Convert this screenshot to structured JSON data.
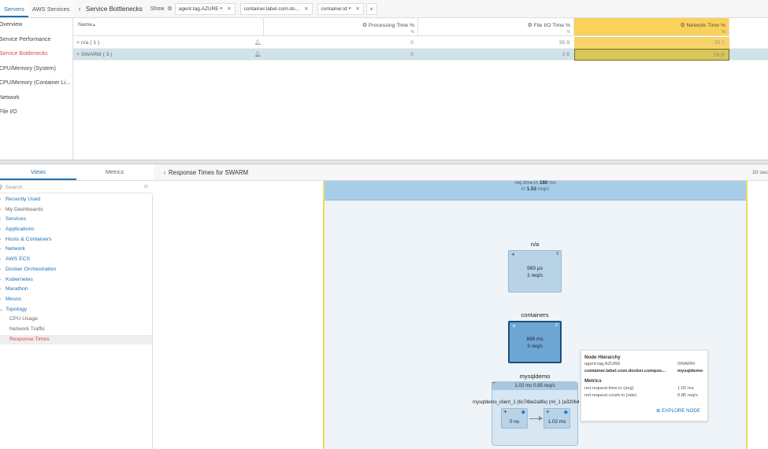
{
  "top_tabs": [
    "Servers",
    "AWS Services"
  ],
  "left_nav": [
    "Overview",
    "Service Performance",
    "Service Bottlenecks",
    "CPU/Memory (System)",
    "CPU/Memory (Container Lim...",
    "Network",
    "File I/O"
  ],
  "header": {
    "title": "Service Bottlenecks",
    "show_label": "Show",
    "chips": [
      "agent.tag.AZURE",
      "container.label.com.do...",
      "container.id"
    ],
    "add": "+"
  },
  "table": {
    "columns": [
      {
        "label": "Name",
        "sort": "▴",
        "unit": ""
      },
      {
        "label": "Processing Time %",
        "unit": "%"
      },
      {
        "label": "File I/O Time %",
        "unit": "%"
      },
      {
        "label": "Network Time %",
        "unit": "%"
      }
    ],
    "rows": [
      {
        "name": "n/a ( 1 )",
        "processing": "0",
        "fileio": "35.9",
        "network": "39.1"
      },
      {
        "name": "SWARM ( 3 )",
        "processing": "0",
        "fileio": "3.6",
        "network": "76.9"
      }
    ]
  },
  "lower_tabs": [
    "Views",
    "Metrics"
  ],
  "search": {
    "placeholder": "Search"
  },
  "tree": [
    {
      "label": "Recently Used",
      "link": true
    },
    {
      "label": "My Dashboards",
      "link": false
    },
    {
      "label": "Services",
      "link": true
    },
    {
      "label": "Applications",
      "link": true
    },
    {
      "label": "Hosts & Containers",
      "link": true
    },
    {
      "label": "Network",
      "link": true
    },
    {
      "label": "AWS ECS",
      "link": true
    },
    {
      "label": "Docker Orchestration",
      "link": true
    },
    {
      "label": "Kubernetes",
      "link": true
    },
    {
      "label": "Marathon",
      "link": true
    },
    {
      "label": "Mesos",
      "link": true
    },
    {
      "label": "Topology",
      "link": true
    },
    {
      "label": "CPU Usage",
      "link": false
    },
    {
      "label": "Network Traffic",
      "link": false
    },
    {
      "label": "Response Times",
      "link": false
    }
  ],
  "panel": {
    "title": "Response Times for SWARM",
    "seconds": "10 sec"
  },
  "topology": {
    "top_line1_pre": "req.time.in",
    "top_line1_val": "180",
    "top_line1_unit": "ms",
    "top_line2_pre": "in",
    "top_line2_val": "1.53",
    "top_line2_unit": "req/s",
    "na": {
      "title": "n/a",
      "count": "3",
      "time": "560 µs",
      "rate": "1 req/s"
    },
    "containers": {
      "title": "containers",
      "count": "2",
      "time": "899 ms",
      "rate": "3 req/s"
    },
    "group": {
      "title": "mysqldemo",
      "bar": "1.02 ms  0.85 req/s",
      "sub_label": "mysqldemo_client_1 (6c74be2a8fe) (ml_1 (a32064",
      "node1": "0 ns",
      "node2": "1.02 ms"
    }
  },
  "tooltip": {
    "hierarchy_title": "Node Hierarchy",
    "rows": [
      {
        "k": "agent.tag.AZURE",
        "v": "SWARM",
        "bold": false
      },
      {
        "k": "container.label.com.docker.compos...",
        "v": "mysqldemo",
        "bold": true
      }
    ],
    "metrics_title": "Metrics",
    "metrics": [
      {
        "k": "net.request.time.in (avg)",
        "v": "1.02 ms"
      },
      {
        "k": "net.request.count.in (rate)",
        "v": "0.85 req/s"
      }
    ],
    "explore": "EXPLORE NODE"
  }
}
